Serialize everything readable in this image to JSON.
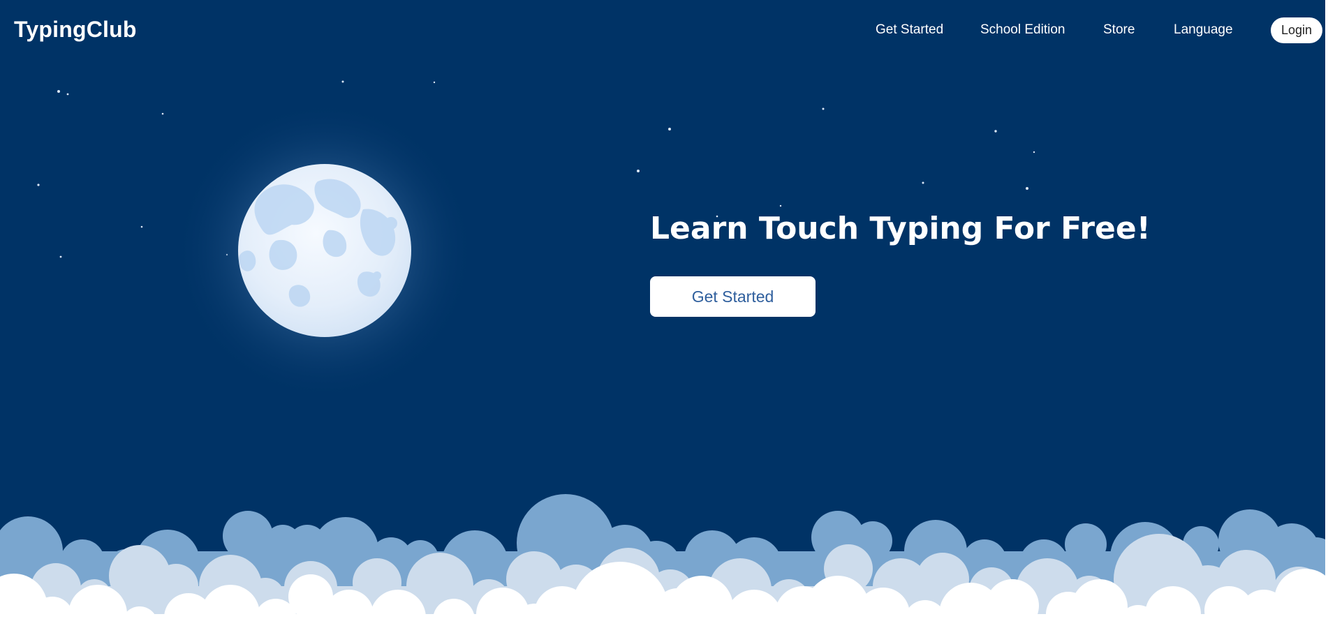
{
  "header": {
    "logo": "TypingClub",
    "nav": [
      "Get Started",
      "School Edition",
      "Store",
      "Language"
    ],
    "login_label": "Login"
  },
  "hero": {
    "title": "Learn Touch Typing For Free!",
    "cta_label": "Get Started"
  },
  "decor": {
    "moon_icon": "full-moon",
    "stars_icon": "stars",
    "clouds_icon": "clouds"
  },
  "colors": {
    "sky": "#003366",
    "cloud_back": "#7aa6cf",
    "cloud_mid": "#cddcec",
    "cloud_front": "#ffffff",
    "moon": "#e6f0fb",
    "button_text": "#2f5f9d"
  }
}
